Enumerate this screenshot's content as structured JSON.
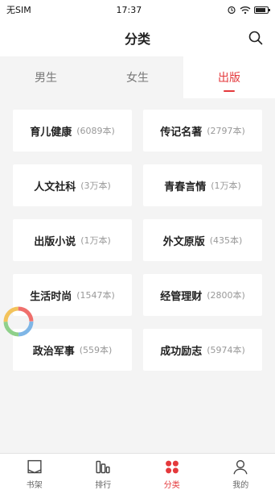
{
  "status": {
    "carrier": "无SIM",
    "time": "17:37"
  },
  "header": {
    "title": "分类"
  },
  "tabs": [
    {
      "label": "男生"
    },
    {
      "label": "女生"
    },
    {
      "label": "出版"
    }
  ],
  "categories": [
    {
      "name": "育儿健康",
      "count": "(6089本)"
    },
    {
      "name": "传记名著",
      "count": "(2797本)"
    },
    {
      "name": "人文社科",
      "count": "(3万本)"
    },
    {
      "name": "青春言情",
      "count": "(1万本)"
    },
    {
      "name": "出版小说",
      "count": "(1万本)"
    },
    {
      "name": "外文原版",
      "count": "(435本)"
    },
    {
      "name": "生活时尚",
      "count": "(1547本)"
    },
    {
      "name": "经管理财",
      "count": "(2800本)"
    },
    {
      "name": "政治军事",
      "count": "(559本)"
    },
    {
      "name": "成功励志",
      "count": "(5974本)"
    }
  ],
  "bottom_nav": [
    {
      "label": "书架",
      "icon": "bookshelf-icon"
    },
    {
      "label": "排行",
      "icon": "ranking-icon"
    },
    {
      "label": "分类",
      "icon": "category-icon"
    },
    {
      "label": "我的",
      "icon": "profile-icon"
    }
  ],
  "colors": {
    "accent": "#e4393c",
    "background": "#f4f4f4"
  }
}
